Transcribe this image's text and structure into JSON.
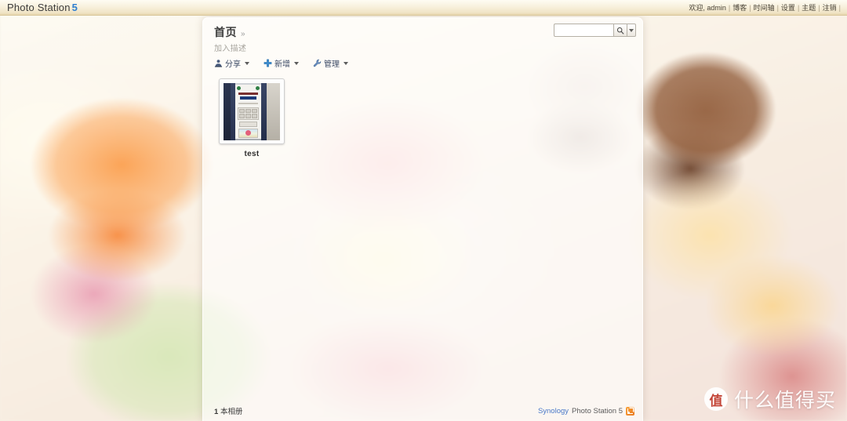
{
  "topbar": {
    "logo_text": "Photo Station",
    "logo_version": "5",
    "welcome": "欢迎, admin",
    "separator": "|",
    "nav": [
      {
        "label": "博客"
      },
      {
        "label": "时间轴"
      },
      {
        "label": "设置"
      },
      {
        "label": "主题"
      },
      {
        "label": "注销"
      }
    ]
  },
  "panel": {
    "breadcrumb": "首页",
    "breadcrumb_sep": "»",
    "description_placeholder": "加入描述",
    "toolbar": [
      {
        "label": "分享",
        "icon": "share-user-icon"
      },
      {
        "label": "新增",
        "icon": "plus-icon"
      },
      {
        "label": "管理",
        "icon": "wrench-icon"
      }
    ],
    "search": {
      "value": "",
      "placeholder": "",
      "button_icon": "search-icon",
      "more_icon": "chevron-down-icon"
    },
    "albums": [
      {
        "label": "test"
      }
    ],
    "footer": {
      "count_number": "1",
      "count_label": "本相册",
      "brand_company": "Synology",
      "brand_product": "Photo Station 5",
      "rss_icon": "rss-icon"
    }
  },
  "watermark": {
    "badge": "值",
    "text": "什么值得买"
  },
  "colors": {
    "accent_blue": "#2f7fd0",
    "brand_link": "#4a79c8",
    "rss_orange": "#e8761c",
    "toolbar_text": "#3c4a66"
  }
}
